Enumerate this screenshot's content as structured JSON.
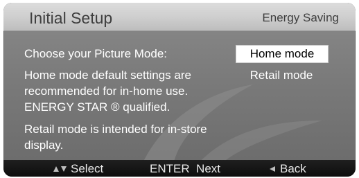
{
  "header": {
    "title": "Initial Setup",
    "subtitle": "Energy Saving"
  },
  "main": {
    "prompt": "Choose your Picture Mode:",
    "home_description": [
      "Home mode default settings are",
      "recommended for in-home use.",
      "ENERGY STAR ® qualified."
    ],
    "retail_description": [
      "Retail mode is intended for in-store",
      "display."
    ],
    "options": [
      {
        "label": "Home mode",
        "selected": true
      },
      {
        "label": "Retail mode",
        "selected": false
      }
    ]
  },
  "footer": {
    "select_label": "Select",
    "next_label": "ENTER  Next",
    "back_label": "Back",
    "icons": [
      "up-down-arrow-icon",
      "left-arrow-icon"
    ]
  },
  "colors": {
    "background": "#7a7a7a",
    "header": "#cfcfcf",
    "footer": "#141414",
    "selected_option": "#ffffff",
    "text": "#ffffff"
  }
}
